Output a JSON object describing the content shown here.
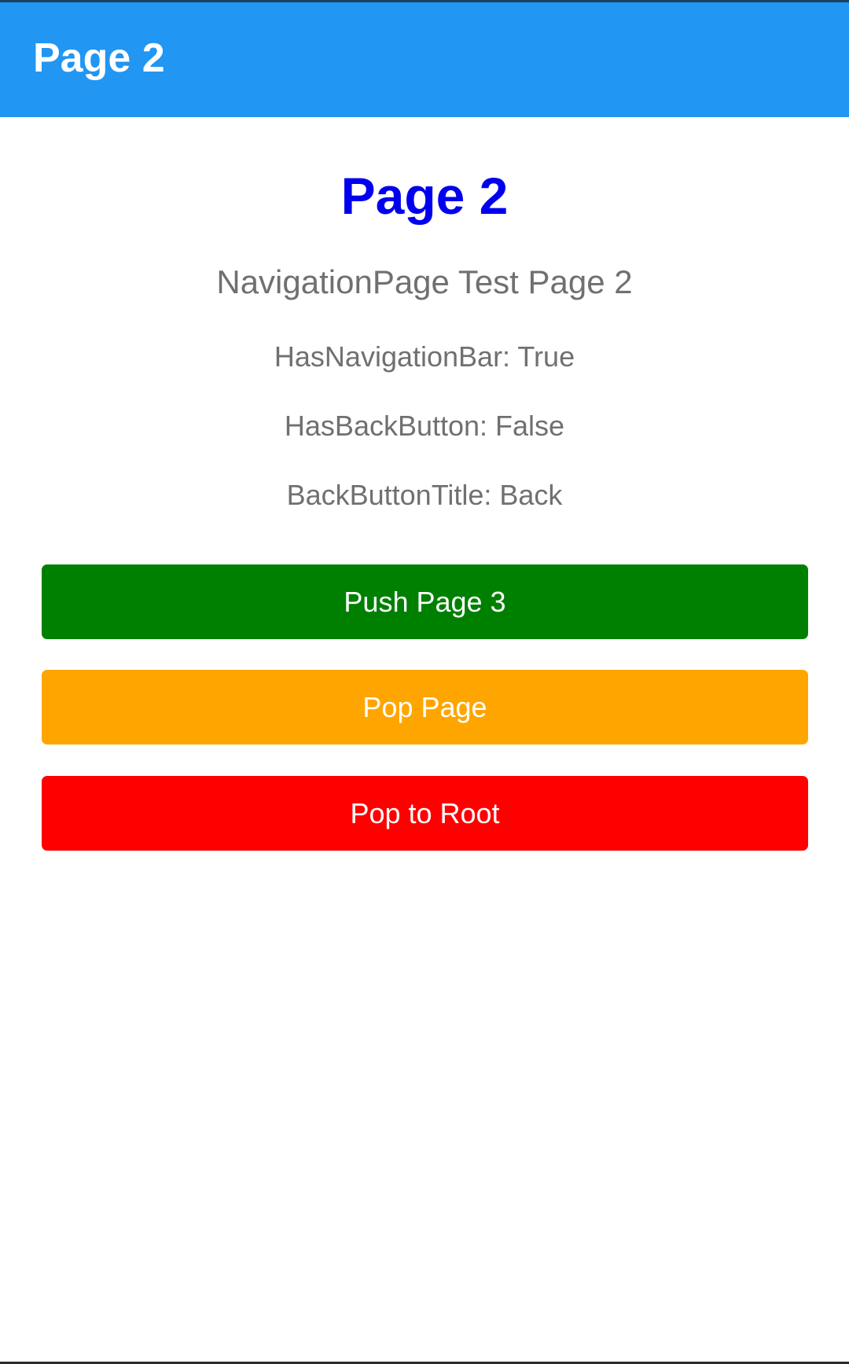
{
  "app_bar": {
    "title": "Page 2",
    "color": "#2196f3"
  },
  "page": {
    "heading": "Page 2",
    "heading_color": "#0000ee",
    "subtitle": "NavigationPage Test Page 2",
    "info": [
      "HasNavigationBar: True",
      "HasBackButton: False",
      "BackButtonTitle: Back"
    ]
  },
  "buttons": {
    "push_page_3": {
      "label": "Push Page 3",
      "color": "#008000"
    },
    "pop_page": {
      "label": "Pop Page",
      "color": "#ffa500"
    },
    "pop_to_root": {
      "label": "Pop to Root",
      "color": "#ff0000"
    }
  }
}
